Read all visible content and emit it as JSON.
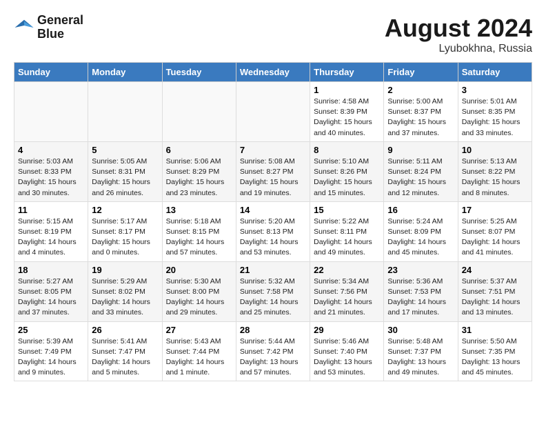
{
  "header": {
    "month_year": "August 2024",
    "location": "Lyubokhna, Russia",
    "logo_line1": "General",
    "logo_line2": "Blue"
  },
  "weekdays": [
    "Sunday",
    "Monday",
    "Tuesday",
    "Wednesday",
    "Thursday",
    "Friday",
    "Saturday"
  ],
  "weeks": [
    [
      {
        "day": "",
        "empty": true
      },
      {
        "day": "",
        "empty": true
      },
      {
        "day": "",
        "empty": true
      },
      {
        "day": "",
        "empty": true
      },
      {
        "day": "1",
        "sunrise": "4:58 AM",
        "sunset": "8:39 PM",
        "daylight": "15 hours and 40 minutes."
      },
      {
        "day": "2",
        "sunrise": "5:00 AM",
        "sunset": "8:37 PM",
        "daylight": "15 hours and 37 minutes."
      },
      {
        "day": "3",
        "sunrise": "5:01 AM",
        "sunset": "8:35 PM",
        "daylight": "15 hours and 33 minutes."
      }
    ],
    [
      {
        "day": "4",
        "sunrise": "5:03 AM",
        "sunset": "8:33 PM",
        "daylight": "15 hours and 30 minutes."
      },
      {
        "day": "5",
        "sunrise": "5:05 AM",
        "sunset": "8:31 PM",
        "daylight": "15 hours and 26 minutes."
      },
      {
        "day": "6",
        "sunrise": "5:06 AM",
        "sunset": "8:29 PM",
        "daylight": "15 hours and 23 minutes."
      },
      {
        "day": "7",
        "sunrise": "5:08 AM",
        "sunset": "8:27 PM",
        "daylight": "15 hours and 19 minutes."
      },
      {
        "day": "8",
        "sunrise": "5:10 AM",
        "sunset": "8:26 PM",
        "daylight": "15 hours and 15 minutes."
      },
      {
        "day": "9",
        "sunrise": "5:11 AM",
        "sunset": "8:24 PM",
        "daylight": "15 hours and 12 minutes."
      },
      {
        "day": "10",
        "sunrise": "5:13 AM",
        "sunset": "8:22 PM",
        "daylight": "15 hours and 8 minutes."
      }
    ],
    [
      {
        "day": "11",
        "sunrise": "5:15 AM",
        "sunset": "8:19 PM",
        "daylight": "14 hours and 4 minutes."
      },
      {
        "day": "12",
        "sunrise": "5:17 AM",
        "sunset": "8:17 PM",
        "daylight": "15 hours and 0 minutes."
      },
      {
        "day": "13",
        "sunrise": "5:18 AM",
        "sunset": "8:15 PM",
        "daylight": "14 hours and 57 minutes."
      },
      {
        "day": "14",
        "sunrise": "5:20 AM",
        "sunset": "8:13 PM",
        "daylight": "14 hours and 53 minutes."
      },
      {
        "day": "15",
        "sunrise": "5:22 AM",
        "sunset": "8:11 PM",
        "daylight": "14 hours and 49 minutes."
      },
      {
        "day": "16",
        "sunrise": "5:24 AM",
        "sunset": "8:09 PM",
        "daylight": "14 hours and 45 minutes."
      },
      {
        "day": "17",
        "sunrise": "5:25 AM",
        "sunset": "8:07 PM",
        "daylight": "14 hours and 41 minutes."
      }
    ],
    [
      {
        "day": "18",
        "sunrise": "5:27 AM",
        "sunset": "8:05 PM",
        "daylight": "14 hours and 37 minutes."
      },
      {
        "day": "19",
        "sunrise": "5:29 AM",
        "sunset": "8:02 PM",
        "daylight": "14 hours and 33 minutes."
      },
      {
        "day": "20",
        "sunrise": "5:30 AM",
        "sunset": "8:00 PM",
        "daylight": "14 hours and 29 minutes."
      },
      {
        "day": "21",
        "sunrise": "5:32 AM",
        "sunset": "7:58 PM",
        "daylight": "14 hours and 25 minutes."
      },
      {
        "day": "22",
        "sunrise": "5:34 AM",
        "sunset": "7:56 PM",
        "daylight": "14 hours and 21 minutes."
      },
      {
        "day": "23",
        "sunrise": "5:36 AM",
        "sunset": "7:53 PM",
        "daylight": "14 hours and 17 minutes."
      },
      {
        "day": "24",
        "sunrise": "5:37 AM",
        "sunset": "7:51 PM",
        "daylight": "14 hours and 13 minutes."
      }
    ],
    [
      {
        "day": "25",
        "sunrise": "5:39 AM",
        "sunset": "7:49 PM",
        "daylight": "14 hours and 9 minutes."
      },
      {
        "day": "26",
        "sunrise": "5:41 AM",
        "sunset": "7:47 PM",
        "daylight": "14 hours and 5 minutes."
      },
      {
        "day": "27",
        "sunrise": "5:43 AM",
        "sunset": "7:44 PM",
        "daylight": "14 hours and 1 minute."
      },
      {
        "day": "28",
        "sunrise": "5:44 AM",
        "sunset": "7:42 PM",
        "daylight": "13 hours and 57 minutes."
      },
      {
        "day": "29",
        "sunrise": "5:46 AM",
        "sunset": "7:40 PM",
        "daylight": "13 hours and 53 minutes."
      },
      {
        "day": "30",
        "sunrise": "5:48 AM",
        "sunset": "7:37 PM",
        "daylight": "13 hours and 49 minutes."
      },
      {
        "day": "31",
        "sunrise": "5:50 AM",
        "sunset": "7:35 PM",
        "daylight": "13 hours and 45 minutes."
      }
    ]
  ]
}
